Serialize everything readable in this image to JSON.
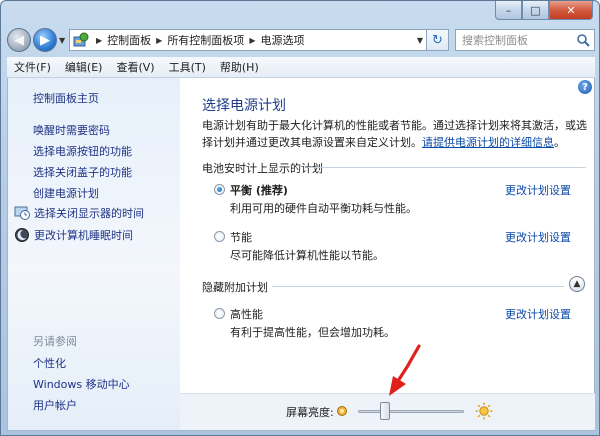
{
  "window": {
    "controls": {
      "minimize": "–",
      "maximize": "□",
      "close": "✕"
    }
  },
  "address": {
    "breadcrumbs": [
      "控制面板",
      "所有控制面板项",
      "电源选项"
    ],
    "search_placeholder": "搜索控制面板"
  },
  "menu": [
    "文件(F)",
    "编辑(E)",
    "查看(V)",
    "工具(T)",
    "帮助(H)"
  ],
  "sidebar": {
    "home": "控制面板主页",
    "links": [
      "唤醒时需要密码",
      "选择电源按钮的功能",
      "选择关闭盖子的功能",
      "创建电源计划"
    ],
    "icon_links": [
      {
        "label": "选择关闭显示器的时间",
        "icon": "display-schedule-icon"
      },
      {
        "label": "更改计算机睡眠时间",
        "icon": "moon-sleep-icon"
      }
    ],
    "see_also": "另请参阅",
    "see_also_links": [
      "个性化",
      "Windows 移动中心",
      "用户帐户"
    ]
  },
  "main": {
    "help": "?",
    "title": "选择电源计划",
    "description": "电源计划有助于最大化计算机的性能或者节能。通过选择计划来将其激活，或选择计划并通过更改其电源设置来自定义计划。",
    "description_link": "请提供电源计划的详细信息",
    "desc_end": "。",
    "group1": "电池安时计上显示的计划",
    "group2": "隐藏附加计划",
    "plans": [
      {
        "name": "平衡 (推荐)",
        "desc": "利用可用的硬件自动平衡功耗与性能。",
        "checked": true,
        "link": "更改计划设置"
      },
      {
        "name": "节能",
        "desc": "尽可能降低计算机性能以节能。",
        "checked": false,
        "link": "更改计划设置"
      },
      {
        "name": "高性能",
        "desc": "有利于提高性能，但会增加功耗。",
        "checked": false,
        "link": "更改计划设置"
      }
    ],
    "brightness_label": "屏幕亮度:",
    "brightness_level": 0.25
  },
  "colors": {
    "link": "#0b49a8",
    "title": "#1f3d8a",
    "sidebar_link": "#1e3287",
    "annotation_arrow": "#e0201a"
  }
}
